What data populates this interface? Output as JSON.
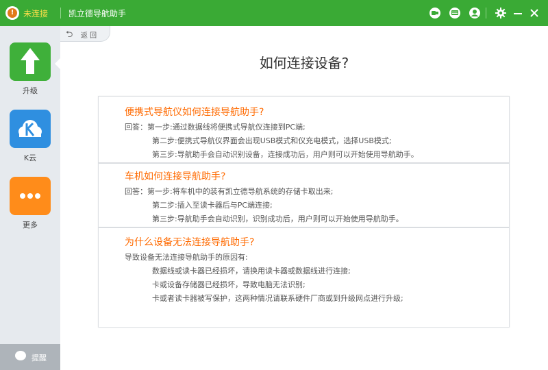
{
  "titlebar": {
    "status": "未连接",
    "app_name": "凯立德导航助手",
    "icons": [
      "connect-device-icon",
      "message-icon",
      "user-icon",
      "settings-icon",
      "minimize-icon",
      "close-icon"
    ]
  },
  "sidebar": {
    "items": [
      {
        "label": "升级",
        "icon": "upgrade-arrow-icon",
        "color": "#3fb03a"
      },
      {
        "label": "K云",
        "icon": "k-cloud-icon",
        "color": "#2f8fe0"
      },
      {
        "label": "更多",
        "icon": "more-dots-icon",
        "color": "#ff8c1a"
      }
    ],
    "feedback_label": "提醒"
  },
  "back": {
    "label": "返 回"
  },
  "page": {
    "title": "如何连接设备?"
  },
  "sections": [
    {
      "title": "便携式导航仪如何连接导航助手?",
      "lines": [
        "回答：第一步:通过数据线将便携式导航仪连接到PC端;",
        "第二步:便携式导航仪界面会出现USB模式和仪充电模式，选择USB模式;",
        "第三步:导航助手会自动识别设备，连接成功后，用户则可以开始使用导航助手。"
      ]
    },
    {
      "title": "车机如何连接导航助手?",
      "lines": [
        "回答：第一步:将车机中的装有凯立德导航系统的存储卡取出来;",
        "第二步:插入至读卡器后与PC端连接;",
        "第三步:导航助手会自动识别，识别成功后，用户则可以开始使用导航助手。"
      ]
    },
    {
      "title": "为什么设备无法连接导航助手?",
      "lines": [
        "导致设备无法连接导航助手的原因有:",
        "数据线或读卡器已经损坏，请换用读卡器或数据线进行连接;",
        "卡或设备存储器已经损坏，导致电脑无法识别;",
        "卡或者读卡器被写保护，这两种情况请联系硬件厂商或到升级网点进行升级;"
      ]
    }
  ],
  "colors": {
    "brand_green": "#3aaa35",
    "question_orange": "#ff6a00",
    "status_yellow": "#ffe04a"
  }
}
